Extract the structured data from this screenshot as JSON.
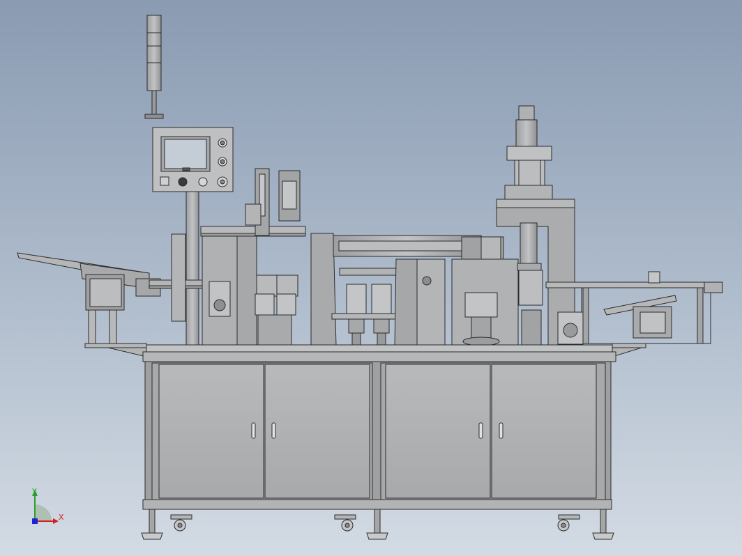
{
  "colors": {
    "body_gray": "#a9a9ab",
    "panel_gray": "#b7b8ba",
    "dark_gray": "#6d6e70",
    "outline": "#2b2b2b",
    "screen_blue": "#c4ccd6",
    "axis_x": "#d42020",
    "axis_y": "#2aa02a",
    "axis_z": "#2020d4"
  },
  "triad": {
    "x_label": "X",
    "y_label": "Y"
  }
}
